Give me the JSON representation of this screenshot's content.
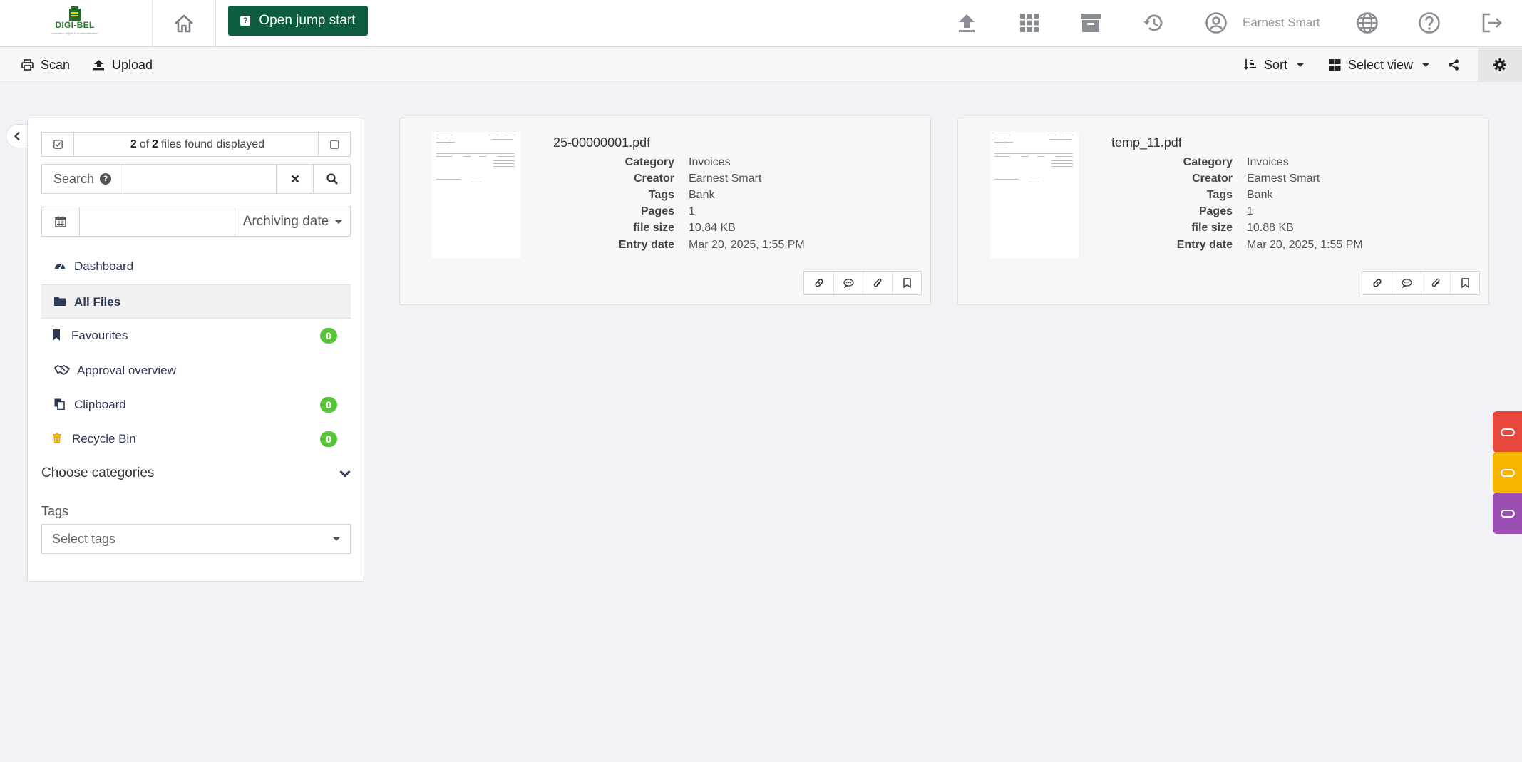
{
  "header": {
    "brand": "DIGI-BEL",
    "tagline": "innovation digital & dematerialisation",
    "jump_start_label": "Open jump start",
    "user_name": "Earnest Smart"
  },
  "toolbar": {
    "scan_label": "Scan",
    "upload_label": "Upload",
    "sort_label": "Sort",
    "view_label": "Select view"
  },
  "sidebar": {
    "count": {
      "shown": "2",
      "of": "of",
      "total": "2",
      "suffix": "files found displayed"
    },
    "search": {
      "label": "Search",
      "value": ""
    },
    "date": {
      "value": "",
      "field_label": "Archiving date"
    },
    "nav": [
      {
        "label": "Dashboard"
      },
      {
        "label": "All Files"
      },
      {
        "label": "Favourites",
        "badge": "0"
      },
      {
        "label": "Approval overview"
      },
      {
        "label": "Clipboard",
        "badge": "0"
      },
      {
        "label": "Recycle Bin",
        "badge": "0"
      }
    ],
    "categories_label": "Choose categories",
    "tags_label": "Tags",
    "tags_placeholder": "Select tags"
  },
  "meta_labels": {
    "category": "Category",
    "creator": "Creator",
    "tags": "Tags",
    "pages": "Pages",
    "file_size": "file size",
    "entry_date": "Entry date"
  },
  "files": [
    {
      "name": "25-00000001.pdf",
      "category": "Invoices",
      "creator": "Earnest Smart",
      "tags": "Bank",
      "pages": "1",
      "file_size": "10.84 KB",
      "entry_date": "Mar 20, 2025, 1:55 PM"
    },
    {
      "name": "temp_11.pdf",
      "category": "Invoices",
      "creator": "Earnest Smart",
      "tags": "Bank",
      "pages": "1",
      "file_size": "10.88 KB",
      "entry_date": "Mar 20, 2025, 1:55 PM"
    }
  ],
  "colors": {
    "primary": "#0c5c3d",
    "badge": "#5cc13b",
    "tab_red": "#e8473d",
    "tab_yellow": "#f6b400",
    "tab_purple": "#9b4fb4"
  }
}
